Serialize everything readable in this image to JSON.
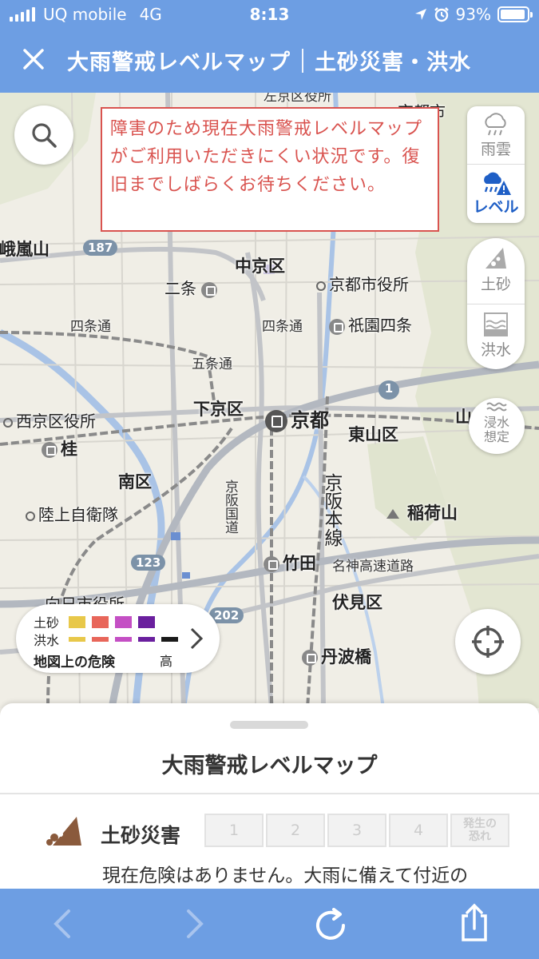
{
  "status_bar": {
    "carrier": "UQ mobile",
    "network": "4G",
    "time": "8:13",
    "battery": "93%",
    "battery_level": 0.93
  },
  "header": {
    "title": "大雨警戒レベルマップ",
    "subtitle": "土砂災害・洪水"
  },
  "notice": {
    "message": "障害のため現在大雨警戒レベルマップがご利用いただきにくい状況です。復旧までしばらくお待ちください。"
  },
  "map_controls": {
    "rain_cloud": "雨雲",
    "level": "レベル",
    "landslide": "土砂",
    "flood": "洪水",
    "inundation_line1": "浸水",
    "inundation_line2": "想定"
  },
  "map_labels": {
    "sakyo_office": "左京区役所",
    "kyoto_city_top": "京都市",
    "arashiyama": "嵯峨嵐山",
    "nakagyo": "中京区",
    "nijo": "二条",
    "kyoto_city_office": "京都市役所",
    "shijo_dori_w": "四条通",
    "shijo_dori_e": "四条通",
    "gion_shijo": "祇園四条",
    "gojo_dori": "五条通",
    "shimogyo": "下京区",
    "kyoto_station": "京都",
    "nishikyo_office": "西京区役所",
    "katsura": "桂",
    "higashiyama": "東山区",
    "yama_right": "山",
    "minami": "南区",
    "jsdf": "陸上自衛隊",
    "keihan_line": "京阪本線",
    "kyohan_kokudo": "京阪国道",
    "inariyama": "稲荷山",
    "takeda": "竹田",
    "meishin": "名神高速道路",
    "fushimi": "伏見区",
    "muko_office": "向日市役所",
    "tanbabashi": "丹波橋",
    "route_187": "187",
    "route_1": "1",
    "route_123": "123",
    "route_202": "202"
  },
  "legend": {
    "landslide_label": "土砂",
    "flood_label": "洪水",
    "danger_label": "地図上の危険",
    "high_label": "高",
    "landslide_colors": [
      "#e8c84a",
      "#e8665a",
      "#c44fc4",
      "#6a1f9e"
    ],
    "flood_colors": [
      "#e8c84a",
      "#e8665a",
      "#c44fc4",
      "#6a1f9e",
      "#1a1a1a"
    ]
  },
  "sheet": {
    "title": "大雨警戒レベルマップ",
    "hazard_label": "土砂災害",
    "levels": [
      "1",
      "2",
      "3",
      "4"
    ],
    "level_last_line1": "発生の",
    "level_last_line2": "恐れ",
    "status_text": "現在危険はありません。大雨に備えて付近の"
  },
  "colors": {
    "header_blue": "#6d9ee3",
    "notice_red": "#d9534f",
    "active_blue": "#1f5fc6"
  }
}
